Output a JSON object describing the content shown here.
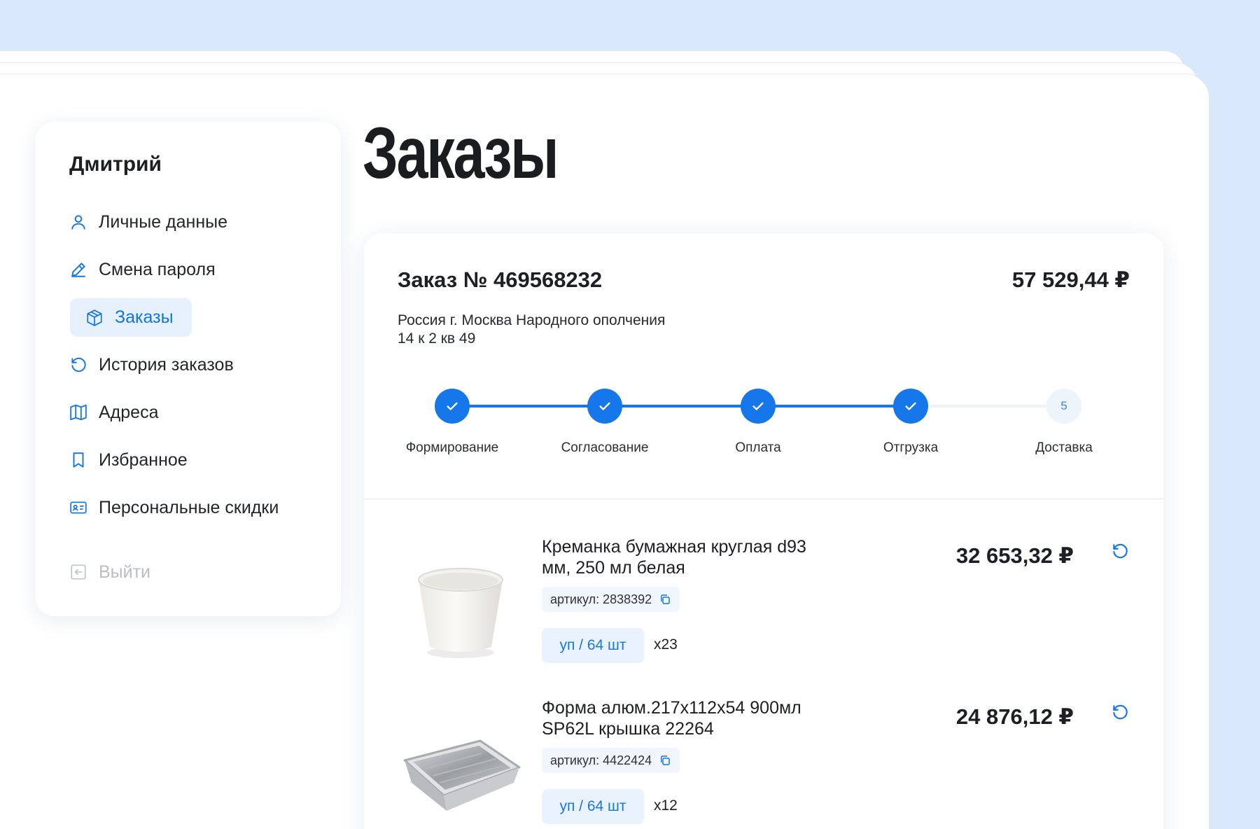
{
  "sidebar": {
    "user_name": "Дмитрий",
    "items": [
      {
        "label": "Личные данные",
        "icon": "user-icon"
      },
      {
        "label": "Смена пароля",
        "icon": "pencil-icon"
      },
      {
        "label": "Заказы",
        "icon": "box-icon",
        "active": true
      },
      {
        "label": "История заказов",
        "icon": "history-icon"
      },
      {
        "label": "Адреса",
        "icon": "map-icon"
      },
      {
        "label": "Избранное",
        "icon": "bookmark-icon"
      },
      {
        "label": "Персональные скидки",
        "icon": "id-card-icon"
      }
    ],
    "logout_label": "Выйти"
  },
  "page": {
    "title": "Заказы"
  },
  "order": {
    "title": "Заказ № 469568232",
    "total": "57 529,44 ₽",
    "address_line1": "Россия г. Москва Народного ополчения",
    "address_line2": "14 к 2 кв 49",
    "steps": [
      {
        "label": "Формирование",
        "done": true
      },
      {
        "label": "Согласование",
        "done": true
      },
      {
        "label": "Оплата",
        "done": true
      },
      {
        "label": "Отгрузка",
        "done": true
      },
      {
        "label": "Доставка",
        "done": false,
        "number": "5"
      }
    ],
    "products": [
      {
        "name_line1": "Креманка бумажная круглая d93",
        "name_line2": "мм, 250 мл белая",
        "sku": "артикул: 2838392",
        "pack": "уп / 64 шт",
        "qty": "x23",
        "price": "32 653,32 ₽"
      },
      {
        "name_line1": "Форма алюм.217x112x54 900мл",
        "name_line2": "SP62L крышка 22264",
        "sku": "артикул: 4422424",
        "pack": "уп / 64 шт",
        "qty": "x12",
        "price": "24 876,12 ₽"
      }
    ]
  },
  "colors": {
    "accent": "#1677ea",
    "active_bg": "#e7f1fd",
    "background": "#d9e9fb"
  }
}
